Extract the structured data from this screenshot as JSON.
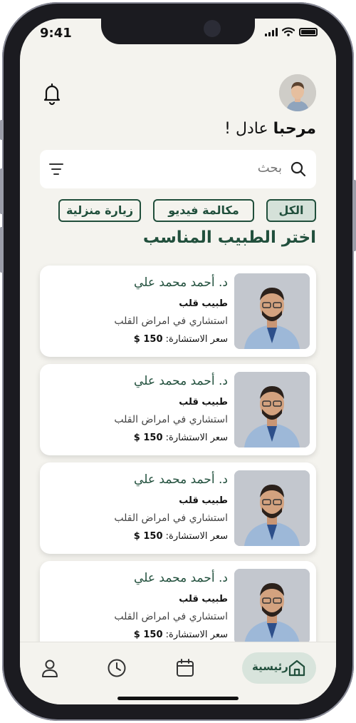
{
  "status_bar": {
    "time": "9:41"
  },
  "header": {
    "greeting_prefix": "مرحبا",
    "greeting_name": "عادل !"
  },
  "search": {
    "placeholder": "بحث"
  },
  "filters": [
    {
      "label": "الكل",
      "active": true
    },
    {
      "label": "مكالمة فيديو",
      "active": false
    },
    {
      "label": "زيارة منزلية",
      "active": false
    }
  ],
  "section_title": "اختر الطبيب المناسب",
  "doctors": [
    {
      "name": "د. أحمد محمد علي",
      "specialty": "طبيب قلب",
      "description": "استشاري في امراض القلب",
      "price_label": "سعر الاستشارة:",
      "price": "150 $"
    },
    {
      "name": "د. أحمد محمد علي",
      "specialty": "طبيب قلب",
      "description": "استشاري في امراض القلب",
      "price_label": "سعر الاستشارة:",
      "price": "150 $"
    },
    {
      "name": "د. أحمد محمد علي",
      "specialty": "طبيب قلب",
      "description": "استشاري في امراض القلب",
      "price_label": "سعر الاستشارة:",
      "price": "150 $"
    },
    {
      "name": "د. أحمد محمد علي",
      "specialty": "طبيب قلب",
      "description": "استشاري في امراض القلب",
      "price_label": "سعر الاستشارة:",
      "price": "150 $"
    }
  ],
  "tabbar": {
    "home_label": "رئيسية",
    "icons": [
      "profile-icon",
      "clock-icon",
      "calendar-icon",
      "home-icon"
    ]
  },
  "colors": {
    "primary": "#214f3c",
    "chip_active": "#d5e1d9",
    "background": "#f4f3ee"
  }
}
